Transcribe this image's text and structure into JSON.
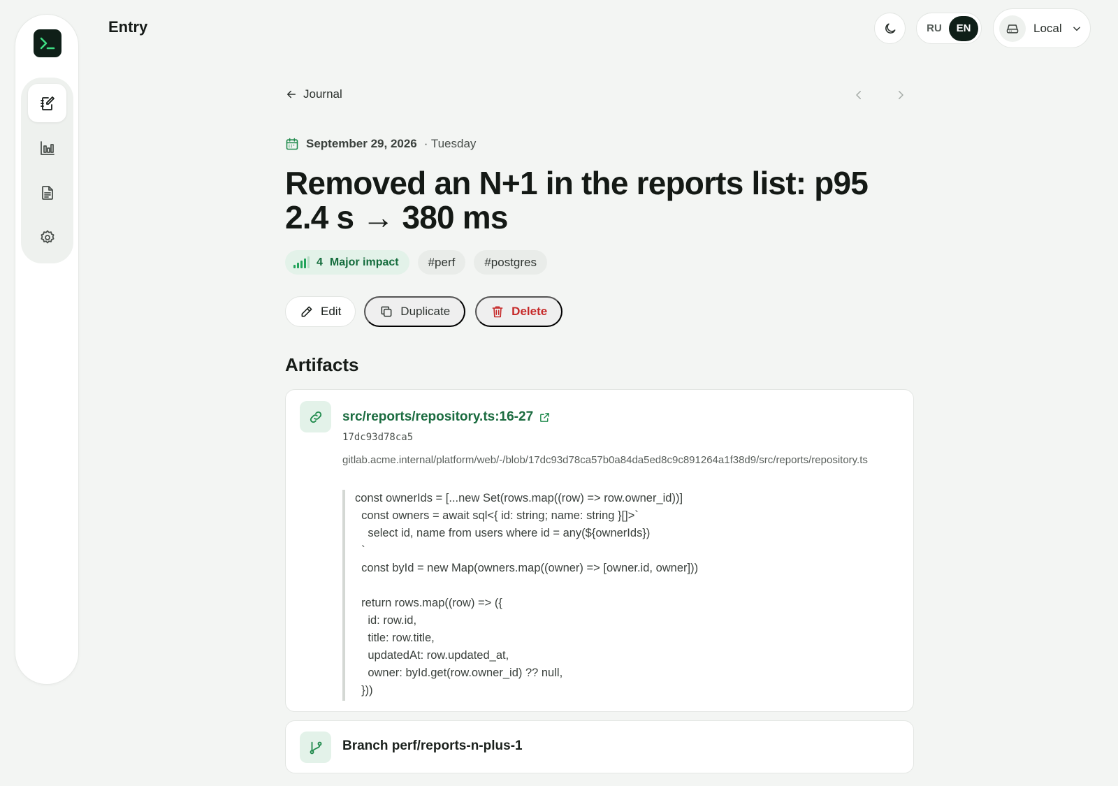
{
  "app": {
    "page_heading": "Entry",
    "theme_icon": "moon-icon",
    "languages": [
      "RU",
      "EN"
    ],
    "active_language": "EN",
    "storage": {
      "label": "Local",
      "icon": "drive-icon"
    }
  },
  "sidebar": {
    "logo_icon": "terminal-icon",
    "items": [
      {
        "name": "journal",
        "icon": "notebook-edit-icon",
        "active": true
      },
      {
        "name": "stats",
        "icon": "bar-chart-icon",
        "active": false
      },
      {
        "name": "reports",
        "icon": "document-icon",
        "active": false
      },
      {
        "name": "settings",
        "icon": "gear-icon",
        "active": false
      }
    ]
  },
  "entry": {
    "back_label": "Journal",
    "date": "September 29, 2026",
    "weekday": "· Tuesday",
    "title": "Removed an N+1 in the reports list: p95 2.4 s → 380 ms",
    "impact": {
      "level": 4,
      "max": 5,
      "label": "Major impact"
    },
    "tags": [
      "#perf",
      "#postgres"
    ],
    "actions": {
      "edit": "Edit",
      "duplicate": "Duplicate",
      "delete": "Delete"
    },
    "colors": {
      "accent": "#1a6b3f",
      "danger": "#c62828",
      "impact_bg": "#e3f2e9"
    }
  },
  "artifacts": {
    "title": "Artifacts",
    "link": {
      "title": "src/reports/repository.ts:16-27",
      "commit": "17dc93d78ca5",
      "url": "gitlab.acme.internal/platform/web/-/blob/17dc93d78ca57b0a84da5ed8c9c891264a1f38d9/src/reports/repository.ts",
      "code": "const ownerIds = [...new Set(rows.map((row) => row.owner_id))]\n  const owners = await sql<{ id: string; name: string }[]>`\n    select id, name from users where id = any(${ownerIds})\n  `\n  const byId = new Map(owners.map((owner) => [owner.id, owner]))\n\n  return rows.map((row) => ({\n    id: row.id,\n    title: row.title,\n    updatedAt: row.updated_at,\n    owner: byId.get(row.owner_id) ?? null,\n  }))"
    },
    "branch": {
      "label": "Branch perf/reports-n-plus-1"
    }
  }
}
